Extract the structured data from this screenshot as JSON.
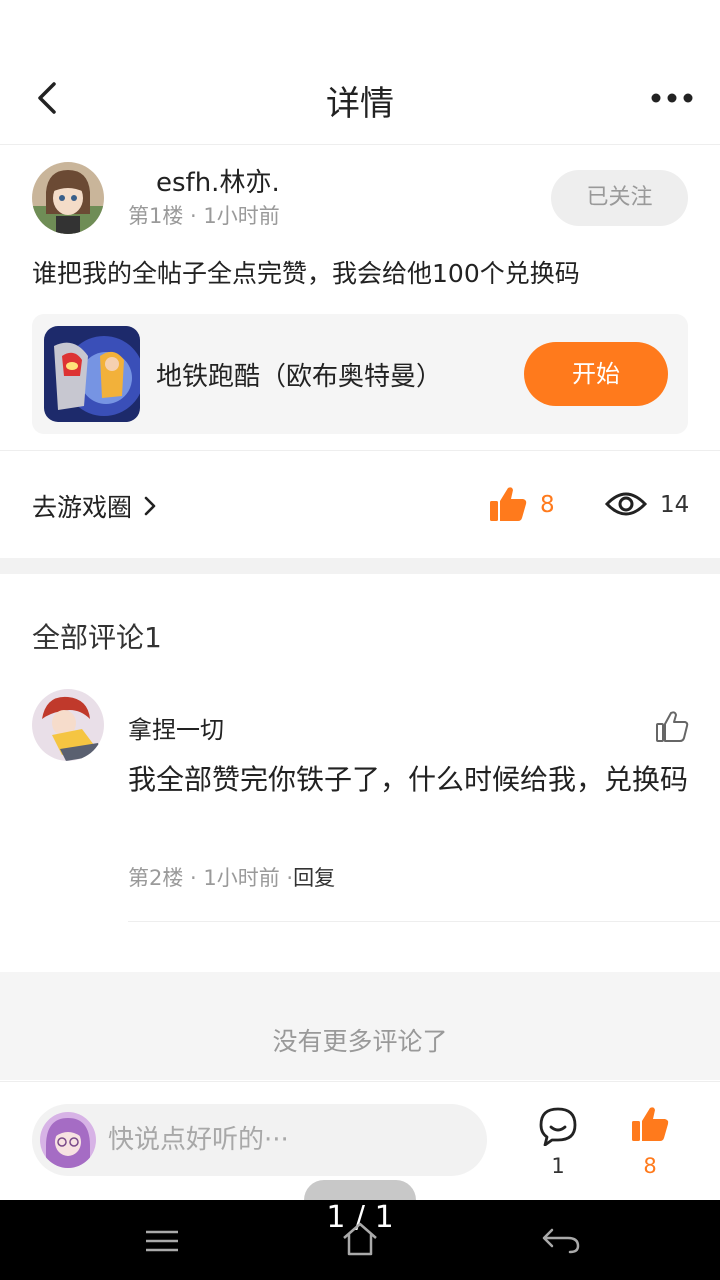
{
  "header": {
    "title": "详情"
  },
  "post": {
    "author": "esfh.林亦.",
    "meta": "第1楼 · 1小时前",
    "follow_label": "已关注",
    "body": "谁把我的全帖子全点完赞，我会给他100个兑换码",
    "game": {
      "title": "地铁跑酷（欧布奥特曼）",
      "start_label": "开始"
    },
    "goto_circle_label": "去游戏圈",
    "like_count": "8",
    "view_count": "14"
  },
  "comments": {
    "heading": "全部评论1",
    "items": [
      {
        "name": "拿捏一切",
        "text": "我全部赞完你铁子了，什么时候给我，兑换码",
        "meta": "第2楼 · 1小时前 ·",
        "reply_label": "回复"
      }
    ],
    "no_more": "没有更多评论了"
  },
  "bottom_bar": {
    "input_placeholder": "快说点好听的···",
    "comment_count": "1",
    "like_count": "8"
  },
  "page_indicator": "1 / 1",
  "colors": {
    "accent": "#ff7a1c",
    "follow_bg": "#eeeeee",
    "card_bg": "#f5f5f5"
  }
}
